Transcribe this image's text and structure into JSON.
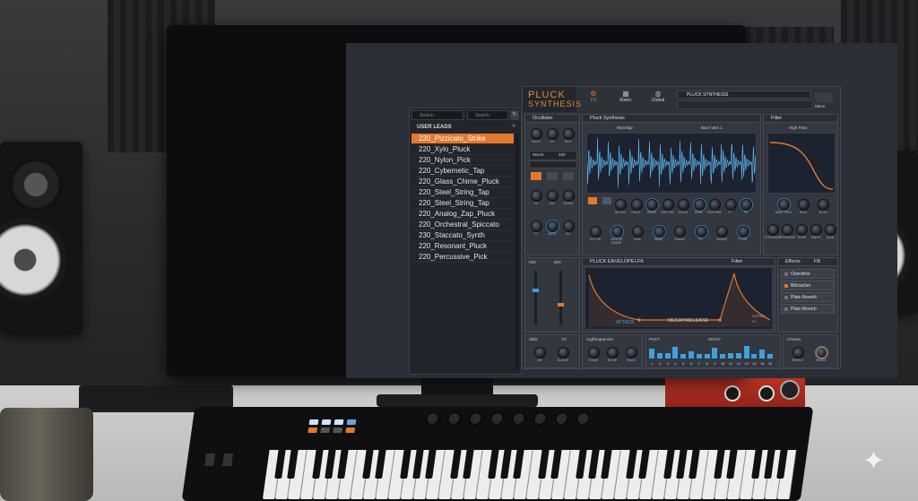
{
  "browser": {
    "search_placeholder": "Search",
    "search2_placeholder": "Search",
    "category_label": "USER LEADS",
    "presets": [
      "220_Pizzicato_Strike",
      "220_Xylo_Pluck",
      "220_Nylon_Pick",
      "220_Cybernetic_Tap",
      "220_Glass_Chime_Pluck",
      "220_Steel_String_Tap",
      "220_Steel_String_Tap",
      "220_Analog_Zap_Pluck",
      "220_Orchestral_Spiccato",
      "230_Staccato_Synth",
      "220_Resonant_Pluck",
      "220_Percussive_Pick"
    ]
  },
  "synth": {
    "logo_line1": "PLUCK",
    "logo_line2": "SYNTHESIS",
    "tabs": [
      {
        "label": "FX",
        "icon": "fx-icon"
      },
      {
        "label": "Matric",
        "icon": "matrix-icon"
      },
      {
        "label": "Global",
        "icon": "globe-icon"
      }
    ],
    "preset_name": "PLUCK SYNTHESIS",
    "menu_label": "Menu",
    "oscillator": {
      "title": "Occilister",
      "knobs": [
        "BACE",
        "VK",
        "BXIT"
      ],
      "wave_label": "Wavst",
      "wave_value": "330",
      "bottom_knobs": [
        "FX",
        "MIX",
        "ROMA",
        "FT",
        "ADVE",
        "ZK-"
      ]
    },
    "pluck_synthesis": {
      "title": "Pluck Synthesis",
      "mode_left": "Wanelap",
      "mode_right": "Back Vam 1",
      "knob_row1": [
        "BLYGE",
        "KNIZE",
        "RNAR",
        "SOFFER",
        "SNOK",
        "MINE",
        "FATFEBE",
        "FT",
        "FS"
      ],
      "knob_row2": [
        "ESTUK",
        "DEVUM NOBIE",
        "LINE",
        "SANE",
        "GNIME",
        "FS",
        "NOIMS",
        "FLKIE"
      ]
    },
    "filter": {
      "title": "Filter",
      "mode": "High Pass",
      "knobs": [
        "MIKE FEDI",
        "SAIV",
        "NOIS"
      ],
      "bottom_knobs": [
        "FORMANT",
        "ROMANNE",
        "TRME",
        "MNPE",
        "NAIS"
      ]
    },
    "envelope": {
      "side_labels": [
        "MIX",
        "MIX"
      ],
      "title": "PLUCK ENVELOPE",
      "lfo_label": "LFK",
      "filter_label": "Filter",
      "attack_label": "ATTACK",
      "decay_label": "DECAY/RELEASE",
      "sustain_label": "SUSTAIN",
      "xy_label": "XY"
    },
    "effects": {
      "title": "Effects",
      "fb_label": "FB",
      "items": [
        "Overdrive",
        "Bitcracher",
        "Plats Reverb",
        "Plats Reverb"
      ]
    },
    "bottom": {
      "slide_label": "Slids",
      "tx_label": "TX",
      "slide_knobs": [
        "ZIE",
        "KLIENE"
      ],
      "arp_title": "ArgfSequencer",
      "arp_knobs": [
        "HAME",
        "NONE",
        "SNAS"
      ],
      "seq_title": "PACT",
      "seq_label2": "SIGOY",
      "steps": [
        1,
        2,
        3,
        4,
        5,
        6,
        7,
        8,
        9,
        10,
        11,
        12,
        13,
        14,
        15,
        16
      ],
      "step_values": [
        0.7,
        0.4,
        0.35,
        0.8,
        0.3,
        0.5,
        0.3,
        0.3,
        0.75,
        0.3,
        0.4,
        0.35,
        0.9,
        0.3,
        0.6,
        0.3
      ],
      "chorus_title": "CHorus",
      "chorus_knobs": [
        "NIMIKE",
        "SNAZE"
      ]
    }
  },
  "colors": {
    "accent": "#e3782d",
    "wave": "#5fb3e8",
    "step": "#3fa0dc",
    "background": "#2d3138"
  },
  "watermark_icon": "sparkle-icon"
}
